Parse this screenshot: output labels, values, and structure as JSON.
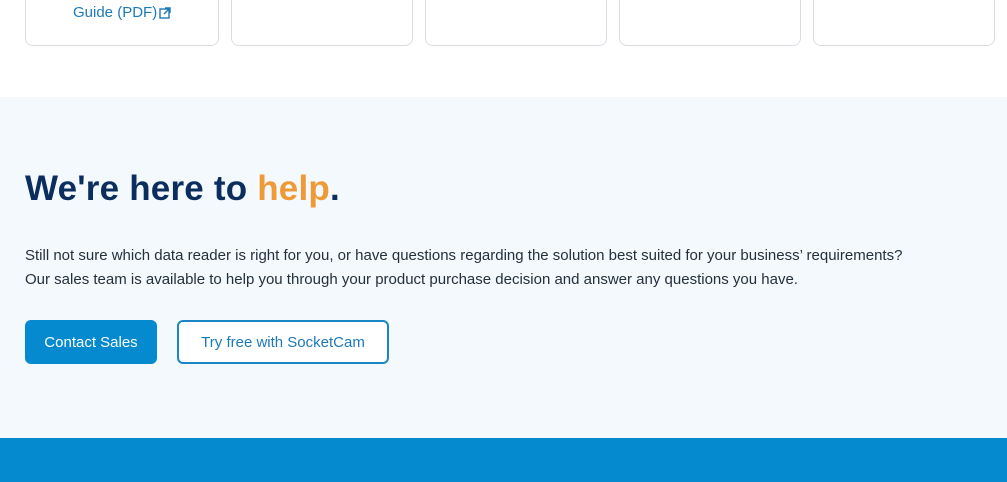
{
  "cards": {
    "guide_link_label": "Guide (PDF)",
    "external_icon": "external-link-icon"
  },
  "help": {
    "title_prefix": "We're here to ",
    "title_accent": "help",
    "title_suffix": ".",
    "text_line1": "Still not sure which data reader is right for you, or have questions regarding the solution best suited for your business’ requirements?",
    "text_line2": "Our sales team is available to help you through your product purchase decision and answer any questions you have.",
    "primary_button": "Contact Sales",
    "secondary_button": "Try free with SocketCam"
  },
  "colors": {
    "navy": "#0b2e5e",
    "accent_orange": "#ee9a37",
    "brand_blue": "#0589cf",
    "link_blue": "#1d7ab8",
    "section_bg": "#f3f9fd"
  }
}
